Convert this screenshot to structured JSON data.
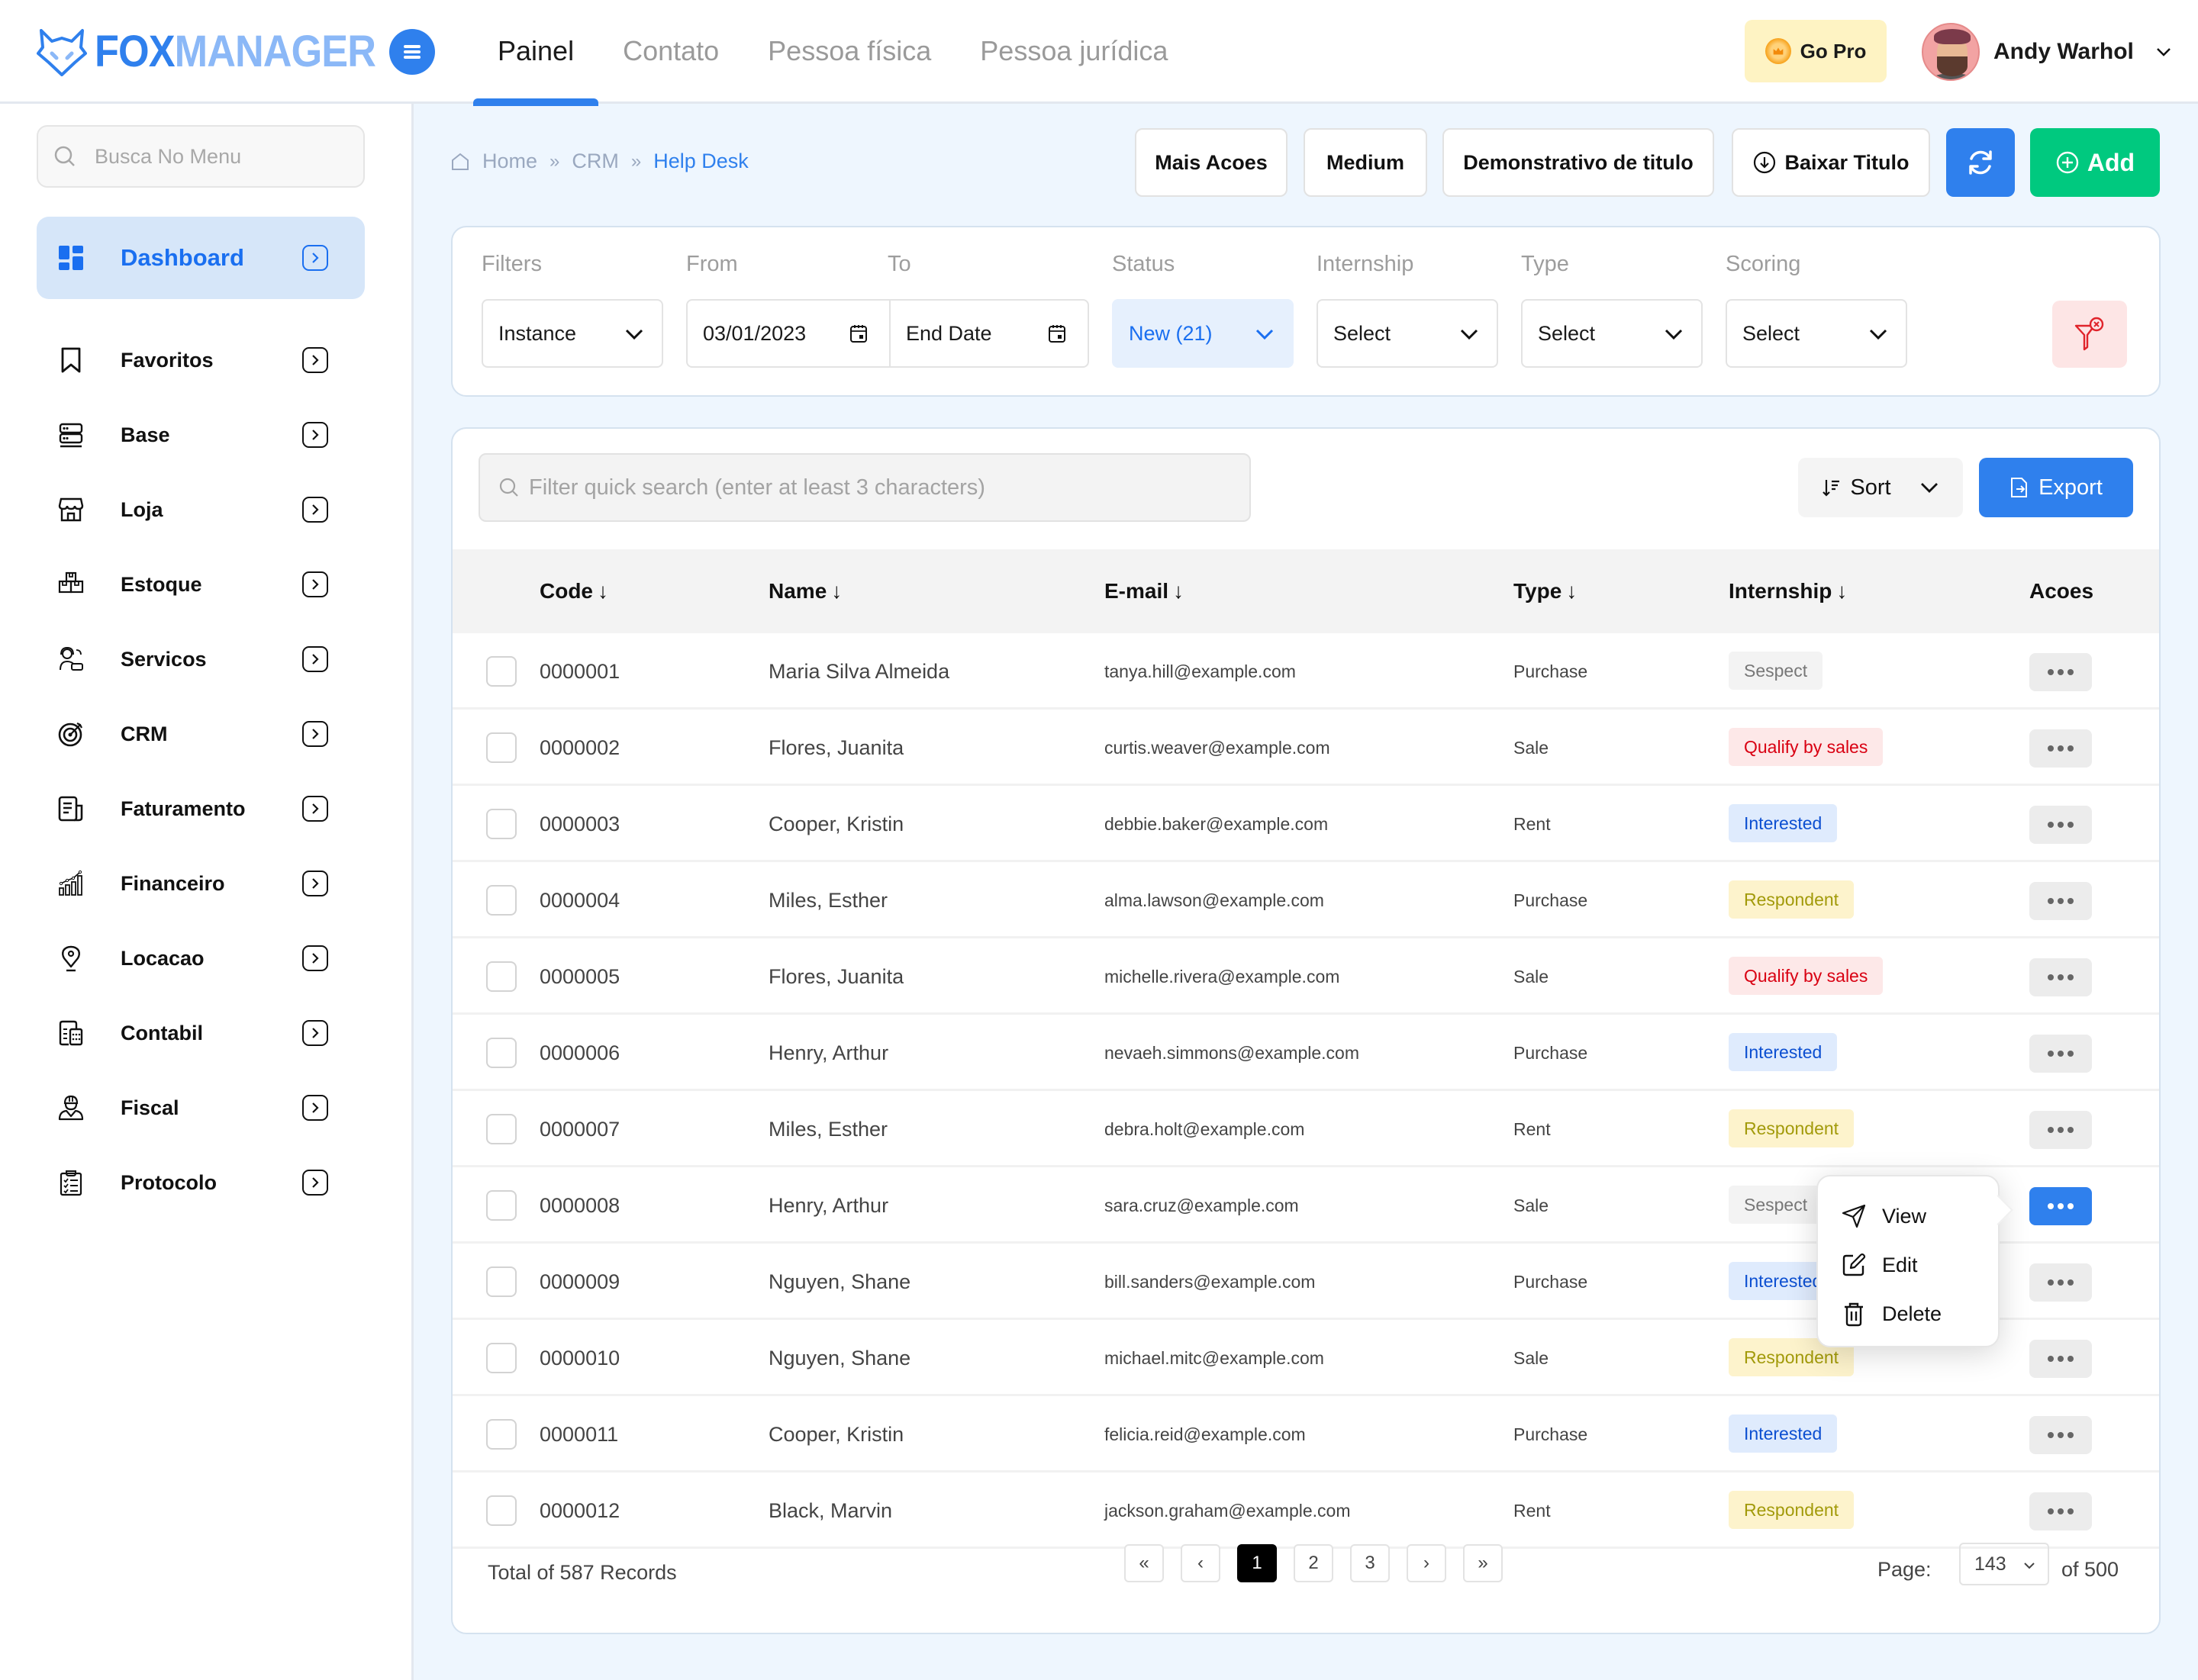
{
  "app": {
    "logo_part1": "FOX",
    "logo_part2": "MANAGER"
  },
  "header": {
    "tabs": [
      {
        "label": "Painel",
        "active": true
      },
      {
        "label": "Contato",
        "active": false
      },
      {
        "label": "Pessoa física",
        "active": false
      },
      {
        "label": "Pessoa jurídica",
        "active": false
      }
    ],
    "gopro_label": "Go Pro",
    "user_name": "Andy Warhol"
  },
  "sidebar": {
    "search_placeholder": "Busca No Menu",
    "items": [
      {
        "label": "Dashboard",
        "icon": "dashboard-icon",
        "active": true
      },
      {
        "label": "Favoritos",
        "icon": "bookmark-icon"
      },
      {
        "label": "Base",
        "icon": "server-icon"
      },
      {
        "label": "Loja",
        "icon": "store-icon"
      },
      {
        "label": "Estoque",
        "icon": "boxes-icon"
      },
      {
        "label": "Servicos",
        "icon": "support-agent-icon"
      },
      {
        "label": "CRM",
        "icon": "target-icon"
      },
      {
        "label": "Faturamento",
        "icon": "invoice-icon"
      },
      {
        "label": "Financeiro",
        "icon": "growth-chart-icon"
      },
      {
        "label": "Locacao",
        "icon": "location-pin-icon"
      },
      {
        "label": "Contabil",
        "icon": "accounting-icon"
      },
      {
        "label": "Fiscal",
        "icon": "worker-icon"
      },
      {
        "label": "Protocolo",
        "icon": "clipboard-checklist-icon"
      }
    ]
  },
  "breadcrumb": {
    "items": [
      "Home",
      "CRM",
      "Help Desk"
    ]
  },
  "toolbar": {
    "mais_acoes": "Mais Acoes",
    "medium": "Medium",
    "demonstrativo": "Demonstrativo de titulo",
    "baixar": "Baixar Titulo",
    "add": "Add"
  },
  "filters": {
    "labels": {
      "filters": "Filters",
      "from": "From",
      "to": "To",
      "status": "Status",
      "internship": "Internship",
      "type": "Type",
      "scoring": "Scoring"
    },
    "instance_value": "Instance",
    "from_value": "03/01/2023",
    "to_placeholder": "End Date",
    "status_value": "New (21)",
    "internship_value": "Select",
    "type_value": "Select",
    "scoring_value": "Select"
  },
  "table": {
    "search_placeholder": "Filter quick search (enter at least 3 characters)",
    "sort_label": "Sort",
    "export_label": "Export",
    "columns": [
      "Code",
      "Name",
      "E-mail",
      "Type",
      "Internship",
      "Acoes"
    ],
    "rows": [
      {
        "code": "0000001",
        "name": "Maria Silva Almeida",
        "email": "tanya.hill@example.com",
        "type": "Purchase",
        "internship": "Sespect",
        "status": "gray"
      },
      {
        "code": "0000002",
        "name": "Flores, Juanita",
        "email": "curtis.weaver@example.com",
        "type": "Sale",
        "internship": "Qualify by sales",
        "status": "red"
      },
      {
        "code": "0000003",
        "name": "Cooper, Kristin",
        "email": "debbie.baker@example.com",
        "type": "Rent",
        "internship": "Interested",
        "status": "blue"
      },
      {
        "code": "0000004",
        "name": "Miles, Esther",
        "email": "alma.lawson@example.com",
        "type": "Purchase",
        "internship": "Respondent",
        "status": "yellow"
      },
      {
        "code": "0000005",
        "name": "Flores, Juanita",
        "email": "michelle.rivera@example.com",
        "type": "Sale",
        "internship": "Qualify by sales",
        "status": "red"
      },
      {
        "code": "0000006",
        "name": "Henry, Arthur",
        "email": "nevaeh.simmons@example.com",
        "type": "Purchase",
        "internship": "Interested",
        "status": "blue"
      },
      {
        "code": "0000007",
        "name": "Miles, Esther",
        "email": "debra.holt@example.com",
        "type": "Rent",
        "internship": "Respondent",
        "status": "yellow"
      },
      {
        "code": "0000008",
        "name": "Henry, Arthur",
        "email": "sara.cruz@example.com",
        "type": "Sale",
        "internship": "Sespect",
        "status": "gray",
        "menu_open": true
      },
      {
        "code": "0000009",
        "name": "Nguyen, Shane",
        "email": "bill.sanders@example.com",
        "type": "Purchase",
        "internship": "Interested",
        "status": "blue"
      },
      {
        "code": "0000010",
        "name": "Nguyen, Shane",
        "email": "michael.mitc@example.com",
        "type": "Sale",
        "internship": "Respondent",
        "status": "yellow"
      },
      {
        "code": "0000011",
        "name": "Cooper, Kristin",
        "email": "felicia.reid@example.com",
        "type": "Purchase",
        "internship": "Interested",
        "status": "blue"
      },
      {
        "code": "0000012",
        "name": "Black, Marvin",
        "email": "jackson.graham@example.com",
        "type": "Rent",
        "internship": "Respondent",
        "status": "yellow"
      }
    ],
    "context_menu": [
      "View",
      "Edit",
      "Delete"
    ]
  },
  "footer": {
    "total": "Total of 587 Records",
    "pages": [
      "1",
      "2",
      "3"
    ],
    "current_page": "1",
    "page_label": "Page:",
    "page_select": "143",
    "page_of": "of 500"
  },
  "colors": {
    "primary": "#2f80ed",
    "success": "#00c97f",
    "badge_gray_bg": "#f3f3f3",
    "badge_gray_fg": "#777777",
    "badge_red_bg": "#fde8e8",
    "badge_red_fg": "#d90012",
    "badge_blue_bg": "#dfebfd",
    "badge_blue_fg": "#0c4fd1",
    "badge_yellow_bg": "#fdf3cc",
    "badge_yellow_fg": "#a29a0a"
  }
}
